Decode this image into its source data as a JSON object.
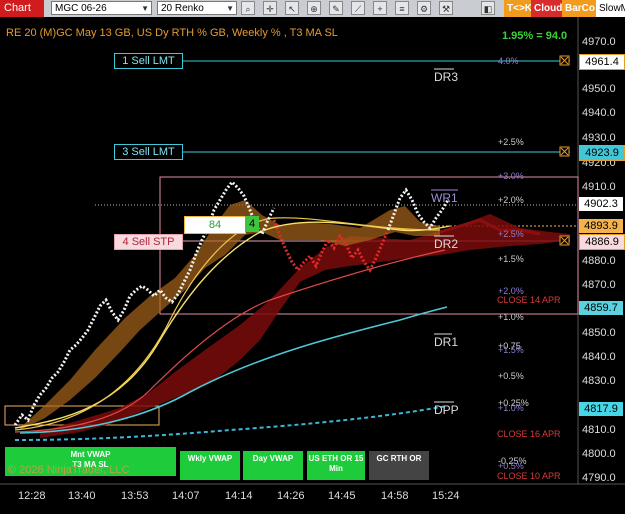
{
  "toolbar": {
    "title": "Chart",
    "instrument": "MGC 06-26",
    "bar_type": "20 Renko",
    "tags": [
      {
        "label": "T<>K",
        "bg": "#f29c1f",
        "fg": "#ffffff"
      },
      {
        "label": "Cloud",
        "bg": "#d82c2c",
        "fg": "#ffffff"
      },
      {
        "label": "BarCo",
        "bg": "#f29c1f",
        "fg": "#ffffff"
      },
      {
        "label": "SlowM",
        "bg": "#ffffff",
        "fg": "#000000"
      }
    ],
    "icons": [
      "search-icon",
      "crosshair-icon",
      "cursor-icon",
      "zoom-icon",
      "pencil-icon",
      "drawing-icon",
      "add-icon",
      "properties-icon",
      "strategy-icon"
    ]
  },
  "header": {
    "title": "RE 20  (M)GC May 13 GB, US Dy RTH % GB, Weekly % , T3 MA SL",
    "pct_readout": "1.95% = 94.0"
  },
  "price_axis": {
    "ticks": [
      "4970.0",
      "4960.0",
      "4950.0",
      "4940.0",
      "4930.0",
      "4920.0",
      "4910.0",
      "4900.0",
      "4890.0",
      "4880.0",
      "4870.0",
      "4860.0",
      "4850.0",
      "4840.0",
      "4830.0",
      "4820.0",
      "4810.0",
      "4800.0",
      "4790.0"
    ],
    "markers": [
      {
        "label": "4961.4",
        "bg": "#ffffff",
        "fg": "#000000",
        "border": "#e79a2c"
      },
      {
        "label": "4923.9",
        "bg": "#40c8d8",
        "fg": "#000000",
        "border": "#e79a2c"
      },
      {
        "label": "4902.3",
        "bg": "#ffffff",
        "fg": "#000000",
        "border": "#ffffff"
      },
      {
        "label": "4893.9",
        "bg": "#f3b24a",
        "fg": "#000000",
        "border": "#f3b24a"
      },
      {
        "label": "4886.9",
        "bg": "#f7d9de",
        "fg": "#000000",
        "border": "#e79a2c"
      },
      {
        "label": "4859.7",
        "bg": "#5ad2e0",
        "fg": "#000000",
        "border": "#5ad2e0"
      },
      {
        "label": "4817.9",
        "bg": "#47d6e6",
        "fg": "#000000",
        "border": "#47d6e6"
      }
    ]
  },
  "time_axis": [
    "12:28",
    "13:40",
    "13:53",
    "14:07",
    "14:14",
    "14:26",
    "14:45",
    "14:58",
    "15:24"
  ],
  "orders": [
    {
      "label": "1 Sell LMT",
      "bg": "#000000",
      "fg": "#7fe3ee",
      "border": "#40c8d8"
    },
    {
      "label": "3 Sell LMT",
      "bg": "#000000",
      "fg": "#7fe3ee",
      "border": "#40c8d8"
    },
    {
      "label": "4 Sell STP",
      "bg": "#f7d9de",
      "fg": "#b0243c",
      "border": "#e7a0ae"
    }
  ],
  "position": {
    "qty": "84",
    "count": "4"
  },
  "levels": [
    {
      "label": "DR3",
      "color": "#dddddd"
    },
    {
      "label": "WR1",
      "color": "#9f8dd6"
    },
    {
      "label": "DR2",
      "color": "#dddddd"
    },
    {
      "label": "DR1",
      "color": "#dddddd"
    },
    {
      "label": "DPP",
      "color": "#dddddd"
    }
  ],
  "pct_labels": [
    {
      "label": "4.0%",
      "color": "#8b7dd6"
    },
    {
      "label": "+2.5%",
      "color": "#cccccc"
    },
    {
      "label": "+3.0%",
      "color": "#8b7dd6"
    },
    {
      "label": "+2.0%",
      "color": "#cccccc"
    },
    {
      "label": "+2.5%",
      "color": "#8b7dd6"
    },
    {
      "label": "+1.5%",
      "color": "#cccccc"
    },
    {
      "label": "+2.0%",
      "color": "#8b7dd6"
    },
    {
      "label": "CLOSE 14 APR",
      "color": "#d83a3a"
    },
    {
      "label": "+1.0%",
      "color": "#cccccc"
    },
    {
      "label": "+0.75",
      "color": "#cccccc"
    },
    {
      "label": "+1.5%",
      "color": "#8b7dd6"
    },
    {
      "label": "+0.5%",
      "color": "#cccccc"
    },
    {
      "label": "+0.25%",
      "color": "#cccccc"
    },
    {
      "label": "+1.0%",
      "color": "#8b7dd6"
    },
    {
      "label": "CLOSE 16 APR",
      "color": "#d83a3a"
    },
    {
      "label": "-0.25%",
      "color": "#cccccc"
    },
    {
      "label": "+0.5%",
      "color": "#8b7dd6"
    },
    {
      "label": "CLOSE 10 APR",
      "color": "#d83a3a"
    }
  ],
  "vwap_buttons": [
    "Mnt VWAP",
    "Wkly VWAP",
    "Day VWAP",
    "US ETH OR 15 Min",
    "GC RTH OR"
  ],
  "overlay_text": {
    "t3_ma": "T3 MA SL",
    "copyright": "© 2026 NinjaTrader, LLC"
  }
}
